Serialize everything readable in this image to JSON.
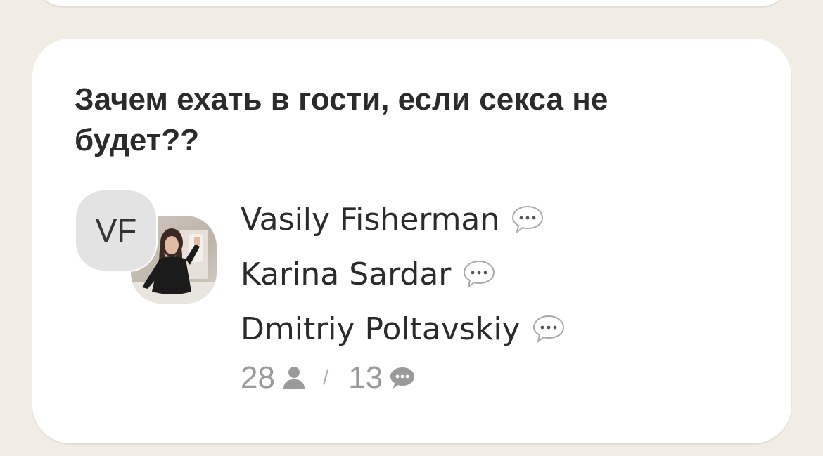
{
  "room": {
    "title": "Зачем ехать в гости, если секса не будет??",
    "host_initials": "VF",
    "speakers": [
      {
        "name": "Vasily Fisherman",
        "icon": "speech-bubble-icon"
      },
      {
        "name": "Karina Sardar",
        "icon": "speech-bubble-icon"
      },
      {
        "name": "Dmitriy Poltavskiy",
        "icon": "speech-bubble-icon"
      }
    ],
    "stats": {
      "listeners": "28",
      "listeners_icon": "person-icon",
      "separator": "/",
      "speakers_count": "13",
      "speakers_icon": "chat-bubble-icon"
    }
  }
}
